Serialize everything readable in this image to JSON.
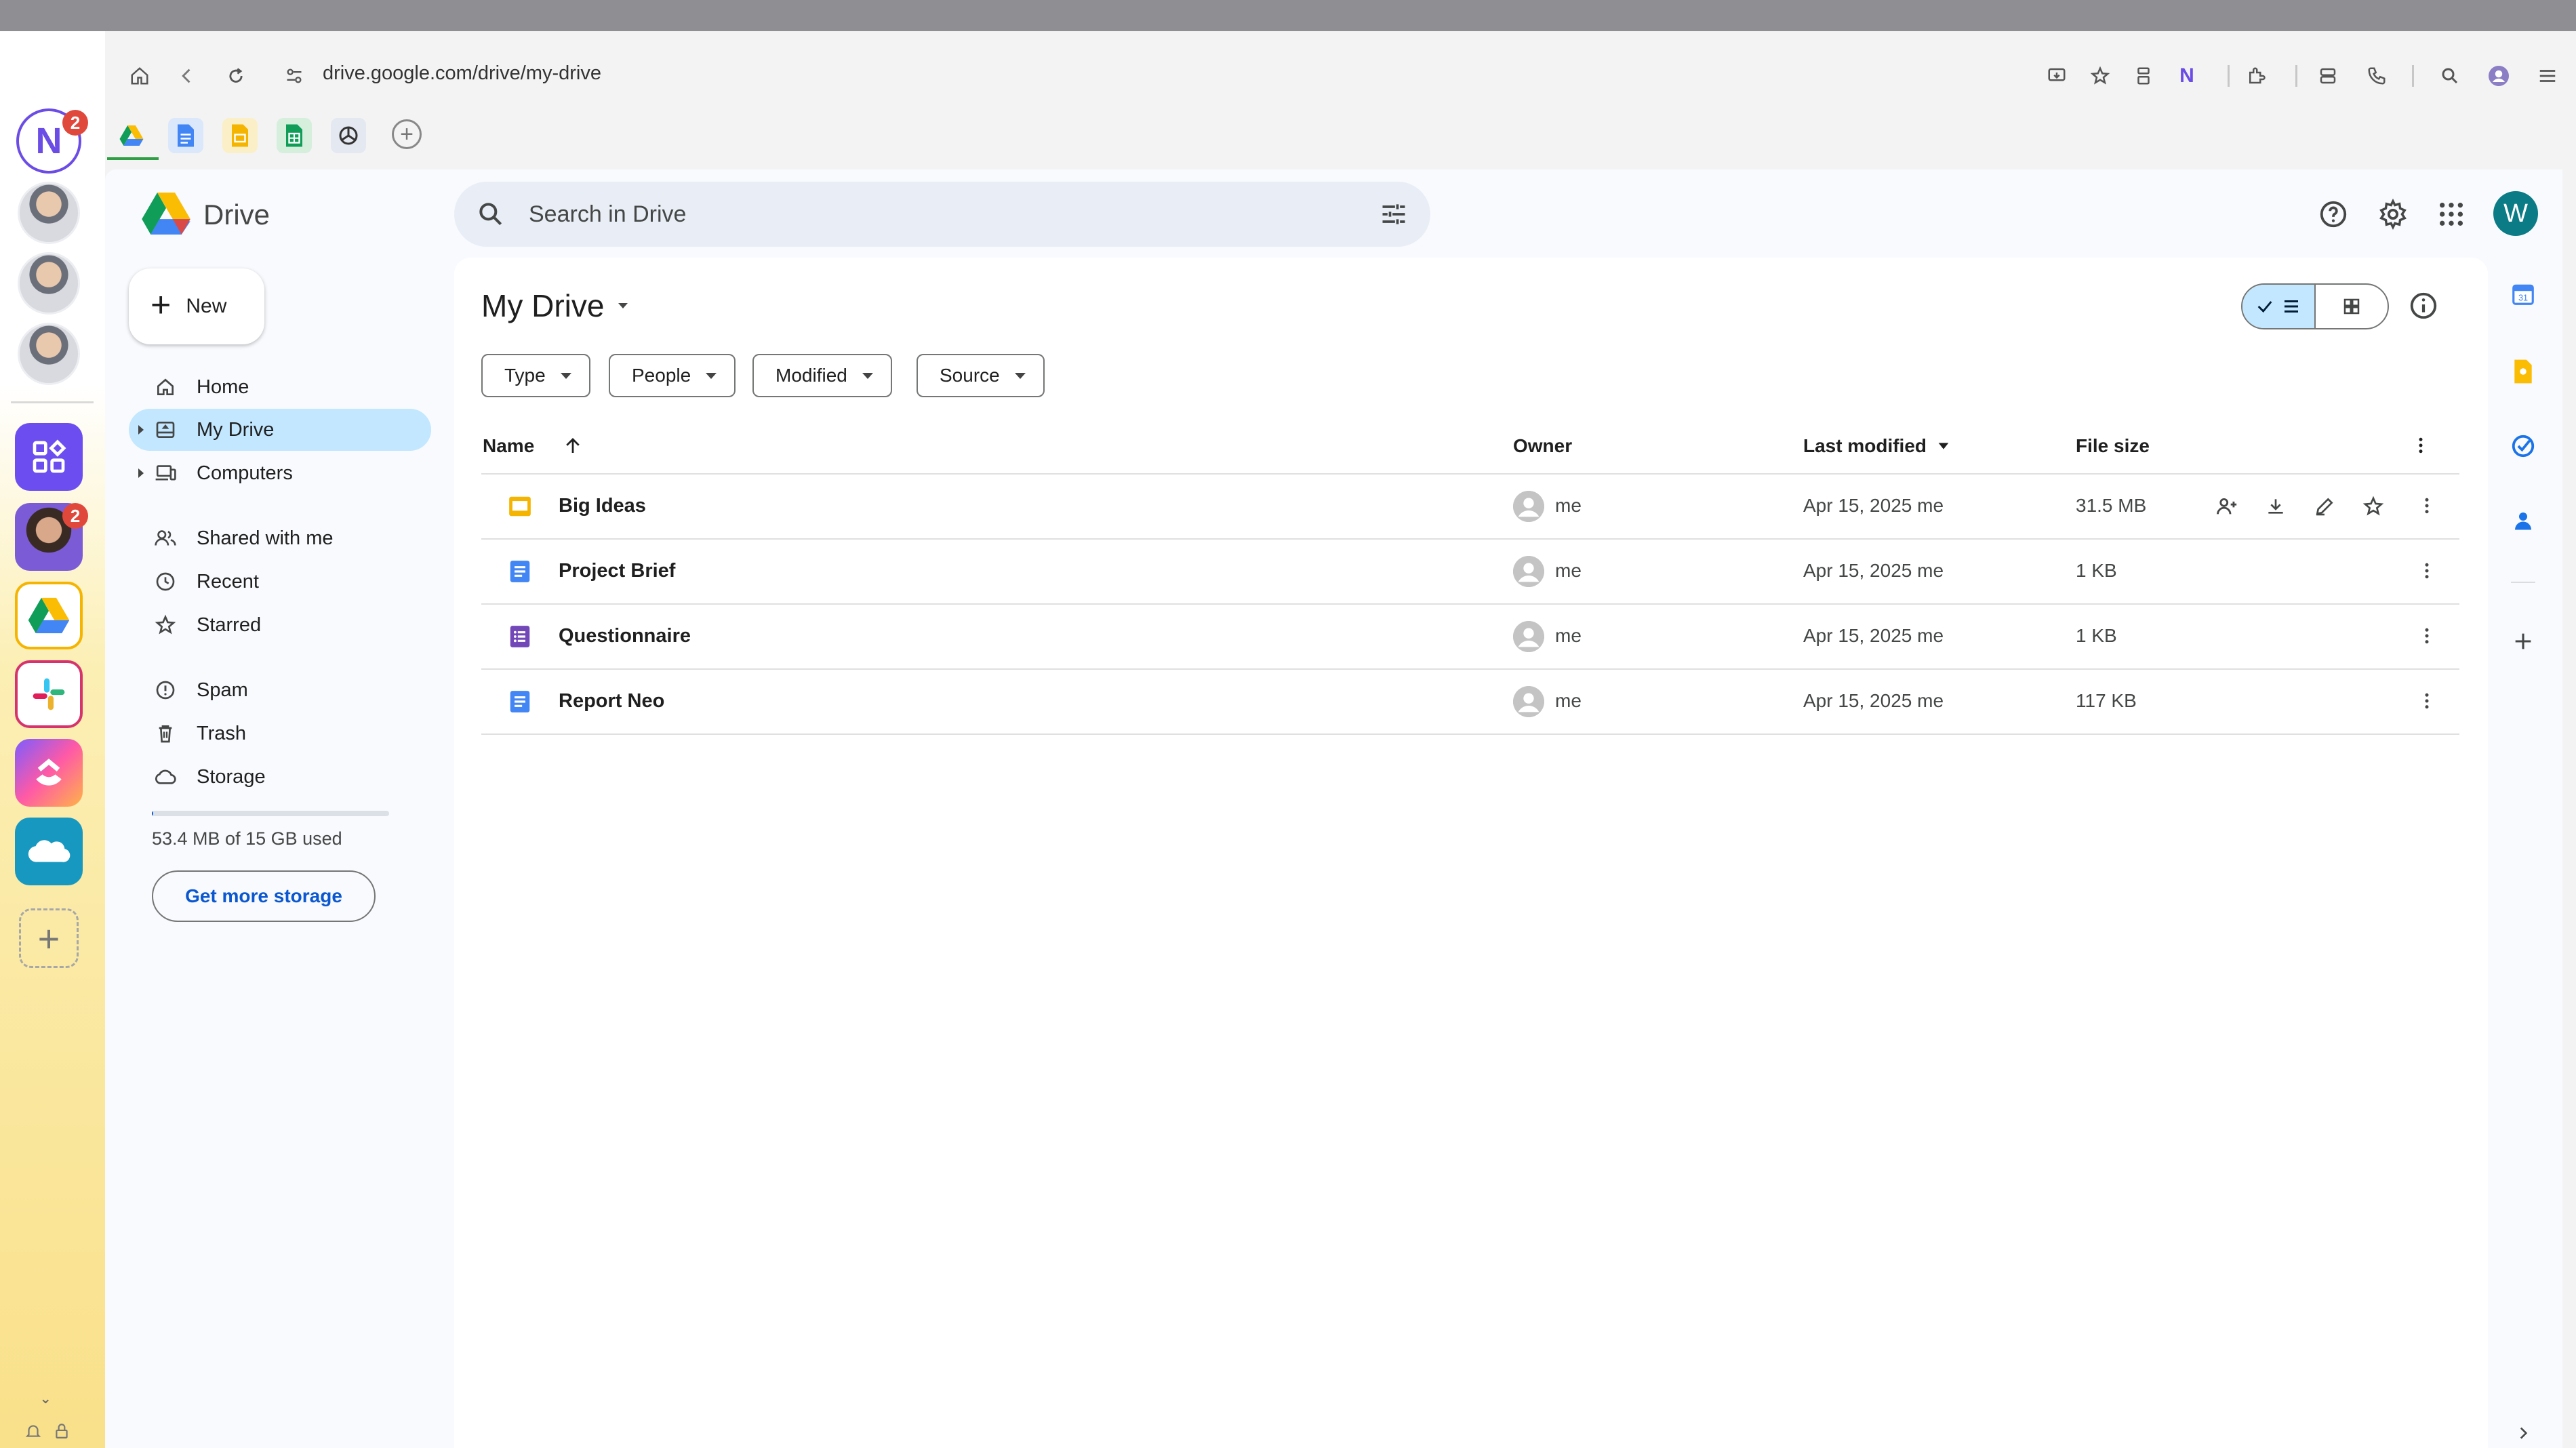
{
  "browser": {
    "url": "drive.google.com/drive/my-drive",
    "tabs": [
      "Google Drive",
      "Google Docs",
      "Google Slides",
      "Google Sheets",
      "ChatGPT"
    ]
  },
  "rail": {
    "workspace_badge": "2",
    "app_badge": "2",
    "logo_letter": "N"
  },
  "drive": {
    "product_name": "Drive",
    "search_placeholder": "Search in Drive",
    "user_initial": "W",
    "new_label": "New",
    "nav": [
      {
        "label": "Home",
        "icon": "home-icon"
      },
      {
        "label": "My Drive",
        "icon": "drive-icon",
        "active": true
      },
      {
        "label": "Computers",
        "icon": "computer-icon"
      },
      {
        "label": "Shared with me",
        "icon": "people-icon"
      },
      {
        "label": "Recent",
        "icon": "clock-icon"
      },
      {
        "label": "Starred",
        "icon": "star-icon"
      },
      {
        "label": "Spam",
        "icon": "spam-icon"
      },
      {
        "label": "Trash",
        "icon": "trash-icon"
      },
      {
        "label": "Storage",
        "icon": "cloud-icon"
      }
    ],
    "storage": {
      "used_text": "53.4 MB of 15 GB used",
      "fraction_used": 0.0035,
      "button_label": "Get more storage"
    },
    "page_title": "My Drive",
    "filters": [
      "Type",
      "People",
      "Modified",
      "Source"
    ],
    "columns": {
      "name": "Name",
      "owner": "Owner",
      "modified": "Last modified",
      "size": "File size"
    },
    "files": [
      {
        "name": "Big Ideas",
        "type": "slides",
        "owner": "me",
        "modified": "Apr 15, 2025 me",
        "size": "31.5 MB"
      },
      {
        "name": "Project Brief",
        "type": "docs",
        "owner": "me",
        "modified": "Apr 15, 2025 me",
        "size": "1 KB"
      },
      {
        "name": "Questionnaire",
        "type": "forms",
        "owner": "me",
        "modified": "Apr 15, 2025 me",
        "size": "1 KB"
      },
      {
        "name": "Report Neo",
        "type": "docs",
        "owner": "me",
        "modified": "Apr 15, 2025 me",
        "size": "117 KB"
      }
    ]
  },
  "colors": {
    "accent": "#0b57d0",
    "selected": "#c2e7ff",
    "slides": "#f4b400",
    "docs": "#4285f4",
    "forms": "#7248b9"
  }
}
